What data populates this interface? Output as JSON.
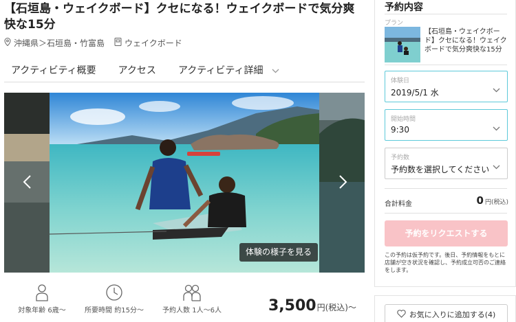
{
  "activity": {
    "title": "【石垣島・ウェイクボード】クセになる！ウェイクボードで気分爽快な15分",
    "location": "沖縄県＞石垣島・竹富島",
    "category": "ウェイクボード"
  },
  "tabs": [
    {
      "label": "アクティビティ概要"
    },
    {
      "label": "アクセス"
    },
    {
      "label": "アクティビティ詳細"
    }
  ],
  "gallery": {
    "view_button": "体験の様子を見る"
  },
  "stats": {
    "age": "対象年齢 6歳〜",
    "duration": "所要時間 約15分〜",
    "people": "予約人数 1人〜6人"
  },
  "price": {
    "amount": "3,500",
    "unit": "円(税込)〜"
  },
  "booking": {
    "title": "予約内容",
    "plan_label": "プラン",
    "plan_text": "【石垣島・ウェイクボード】クセになる！ウェイクボードで気分爽快な15分",
    "date": {
      "label": "体験日",
      "value": "2019/5/1 水"
    },
    "time": {
      "label": "開始時間",
      "value": "9:30"
    },
    "count": {
      "label": "予約数",
      "value": "予約数を選択してください"
    },
    "total_label": "合計料金",
    "total_value": "0",
    "total_unit": "円(税込)",
    "request_button": "予約をリクエストする",
    "note": "この予約は仮予約です。後日、予約情報をもとに店舗が空き状況を確認し、予約成立可否のご連絡をします。"
  },
  "favorite": {
    "label": "お気に入りに追加する(4)"
  },
  "colors": {
    "accent": "#5cc9d9",
    "request_button": "#f9c3c7"
  }
}
